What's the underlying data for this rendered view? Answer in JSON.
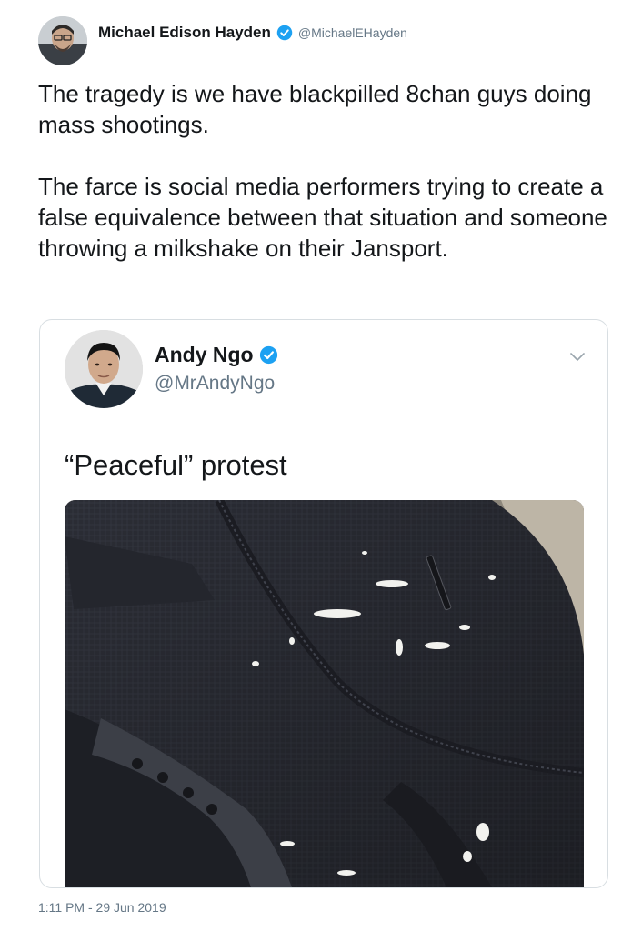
{
  "tweet": {
    "author": {
      "name": "Michael Edison Hayden",
      "handle": "@MichaelEHayden",
      "avatar_icon": "user-avatar",
      "verified_icon": "verified-badge-icon"
    },
    "text": {
      "paragraph1": "The tragedy is we have blackpilled 8chan guys doing mass shootings.",
      "paragraph2": "The farce is social media performers trying to create a false equivalence between that situation and someone throwing a milkshake on their Jansport."
    },
    "timestamp": "1:11 PM - 29 Jun 2019"
  },
  "quoted_tweet": {
    "author": {
      "name": "Andy Ngo",
      "handle": "@MrAndyNgo",
      "avatar_icon": "user-avatar",
      "verified_icon": "verified-badge-icon"
    },
    "text": "“Peaceful” protest",
    "menu_icon": "chevron-down-icon",
    "media_description": "photo-backpack-with-milkshake-splatter"
  },
  "colors": {
    "verified_blue": "#1da1f2",
    "text_primary": "#14171a",
    "text_secondary": "#657786",
    "border": "#d8dee2"
  }
}
